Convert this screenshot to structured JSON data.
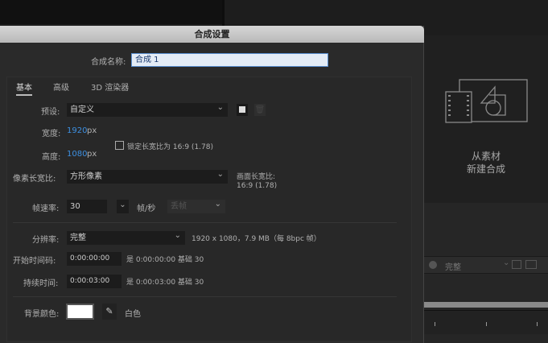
{
  "dialog": {
    "title": "合成设置",
    "name_label": "合成名称:",
    "name_value": "合成 1",
    "tabs": [
      "基本",
      "高级",
      "3D 渲染器"
    ],
    "preset": {
      "label": "预设:",
      "value": "自定义"
    },
    "width": {
      "label": "宽度:",
      "value": "1920",
      "unit": "px"
    },
    "height": {
      "label": "高度:",
      "value": "1080",
      "unit": "px"
    },
    "lock_aspect": {
      "label": "锁定长宽比为 16:9 (1.78)",
      "checked": false
    },
    "pixel_aspect": {
      "label": "像素长宽比:",
      "value": "方形像素"
    },
    "frame_aspect": {
      "label": "画面长宽比:",
      "value": "16:9 (1.78)"
    },
    "frame_rate": {
      "label": "帧速率:",
      "value": "30",
      "unit": "帧/秒",
      "drop_frame": "丢帧"
    },
    "resolution": {
      "label": "分辨率:",
      "value": "完整",
      "info": "1920 x 1080，7.9 MB（每 8bpc 帧）"
    },
    "start_timecode": {
      "label": "开始时间码:",
      "value": "0:00:00:00",
      "info": "是 0:00:00:00  基础 30"
    },
    "duration": {
      "label": "持续时间:",
      "value": "0:00:03:00",
      "info": "是 0:00:03:00  基础 30"
    },
    "background": {
      "label": "背景颜色:",
      "color": "#ffffff",
      "name": "白色"
    }
  },
  "right_panel": {
    "line1": "从素材",
    "line2": "新建合成",
    "toolbar_resolution": "完整"
  },
  "colors": {
    "accent": "#3d8fe0"
  }
}
